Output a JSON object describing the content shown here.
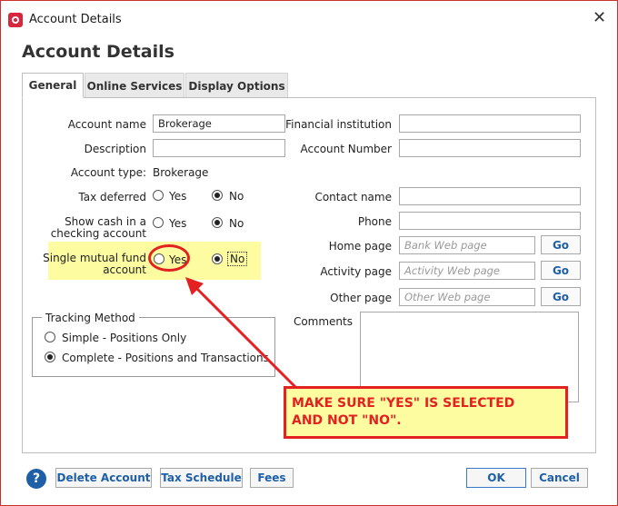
{
  "window": {
    "title": "Account Details",
    "heading": "Account Details"
  },
  "tabs": [
    {
      "label": "General",
      "active": true
    },
    {
      "label": "Online Services",
      "active": false
    },
    {
      "label": "Display Options",
      "active": false
    }
  ],
  "form_left": {
    "account_name_label": "Account name",
    "account_name_value": "Brokerage",
    "description_label": "Description",
    "description_value": "",
    "account_type_label": "Account type:",
    "account_type_value": "Brokerage",
    "tax_deferred_label": "Tax deferred",
    "show_cash_label_line1": "Show cash in a",
    "show_cash_label_line2": "checking account",
    "single_mutual_label_line1": "Single mutual fund",
    "single_mutual_label_line2": "account",
    "yes_label": "Yes",
    "no_label": "No",
    "tax_deferred_selected": "No",
    "show_cash_selected": "No",
    "single_mutual_selected": "No"
  },
  "form_right": {
    "financial_institution_label": "Financial institution",
    "account_number_label": "Account Number",
    "contact_name_label": "Contact name",
    "phone_label": "Phone",
    "home_page_label": "Home page",
    "home_page_placeholder": "Bank Web page",
    "activity_page_label": "Activity page",
    "activity_page_placeholder": "Activity Web page",
    "other_page_label": "Other page",
    "other_page_placeholder": "Other Web page",
    "go_label": "Go",
    "comments_label": "Comments"
  },
  "tracking": {
    "title": "Tracking Method",
    "options": [
      "Simple - Positions Only",
      "Complete - Positions and Transactions"
    ],
    "selected": "Complete - Positions and Transactions"
  },
  "footer": {
    "help_label": "?",
    "delete_account": "Delete Account",
    "tax_schedule": "Tax Schedule",
    "fees": "Fees",
    "ok": "OK",
    "cancel": "Cancel"
  },
  "annotation": {
    "note": "MAKE SURE \"YES\" IS SELECTED\nAND NOT \"NO\".",
    "color": "#e32121",
    "highlight_color": "#fdfca0"
  }
}
